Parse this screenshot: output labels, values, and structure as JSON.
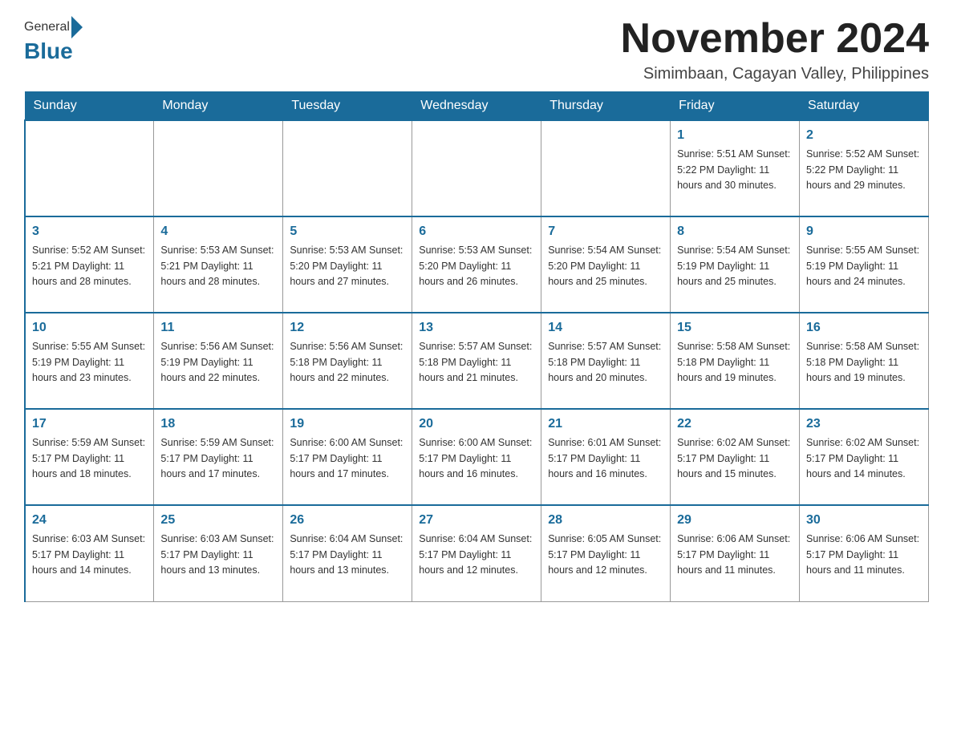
{
  "header": {
    "logo": {
      "general": "General",
      "blue": "Blue"
    },
    "title": "November 2024",
    "subtitle": "Simimbaan, Cagayan Valley, Philippines"
  },
  "weekdays": [
    "Sunday",
    "Monday",
    "Tuesday",
    "Wednesday",
    "Thursday",
    "Friday",
    "Saturday"
  ],
  "weeks": [
    [
      {
        "day": "",
        "info": ""
      },
      {
        "day": "",
        "info": ""
      },
      {
        "day": "",
        "info": ""
      },
      {
        "day": "",
        "info": ""
      },
      {
        "day": "",
        "info": ""
      },
      {
        "day": "1",
        "info": "Sunrise: 5:51 AM\nSunset: 5:22 PM\nDaylight: 11 hours and 30 minutes."
      },
      {
        "day": "2",
        "info": "Sunrise: 5:52 AM\nSunset: 5:22 PM\nDaylight: 11 hours and 29 minutes."
      }
    ],
    [
      {
        "day": "3",
        "info": "Sunrise: 5:52 AM\nSunset: 5:21 PM\nDaylight: 11 hours and 28 minutes."
      },
      {
        "day": "4",
        "info": "Sunrise: 5:53 AM\nSunset: 5:21 PM\nDaylight: 11 hours and 28 minutes."
      },
      {
        "day": "5",
        "info": "Sunrise: 5:53 AM\nSunset: 5:20 PM\nDaylight: 11 hours and 27 minutes."
      },
      {
        "day": "6",
        "info": "Sunrise: 5:53 AM\nSunset: 5:20 PM\nDaylight: 11 hours and 26 minutes."
      },
      {
        "day": "7",
        "info": "Sunrise: 5:54 AM\nSunset: 5:20 PM\nDaylight: 11 hours and 25 minutes."
      },
      {
        "day": "8",
        "info": "Sunrise: 5:54 AM\nSunset: 5:19 PM\nDaylight: 11 hours and 25 minutes."
      },
      {
        "day": "9",
        "info": "Sunrise: 5:55 AM\nSunset: 5:19 PM\nDaylight: 11 hours and 24 minutes."
      }
    ],
    [
      {
        "day": "10",
        "info": "Sunrise: 5:55 AM\nSunset: 5:19 PM\nDaylight: 11 hours and 23 minutes."
      },
      {
        "day": "11",
        "info": "Sunrise: 5:56 AM\nSunset: 5:19 PM\nDaylight: 11 hours and 22 minutes."
      },
      {
        "day": "12",
        "info": "Sunrise: 5:56 AM\nSunset: 5:18 PM\nDaylight: 11 hours and 22 minutes."
      },
      {
        "day": "13",
        "info": "Sunrise: 5:57 AM\nSunset: 5:18 PM\nDaylight: 11 hours and 21 minutes."
      },
      {
        "day": "14",
        "info": "Sunrise: 5:57 AM\nSunset: 5:18 PM\nDaylight: 11 hours and 20 minutes."
      },
      {
        "day": "15",
        "info": "Sunrise: 5:58 AM\nSunset: 5:18 PM\nDaylight: 11 hours and 19 minutes."
      },
      {
        "day": "16",
        "info": "Sunrise: 5:58 AM\nSunset: 5:18 PM\nDaylight: 11 hours and 19 minutes."
      }
    ],
    [
      {
        "day": "17",
        "info": "Sunrise: 5:59 AM\nSunset: 5:17 PM\nDaylight: 11 hours and 18 minutes."
      },
      {
        "day": "18",
        "info": "Sunrise: 5:59 AM\nSunset: 5:17 PM\nDaylight: 11 hours and 17 minutes."
      },
      {
        "day": "19",
        "info": "Sunrise: 6:00 AM\nSunset: 5:17 PM\nDaylight: 11 hours and 17 minutes."
      },
      {
        "day": "20",
        "info": "Sunrise: 6:00 AM\nSunset: 5:17 PM\nDaylight: 11 hours and 16 minutes."
      },
      {
        "day": "21",
        "info": "Sunrise: 6:01 AM\nSunset: 5:17 PM\nDaylight: 11 hours and 16 minutes."
      },
      {
        "day": "22",
        "info": "Sunrise: 6:02 AM\nSunset: 5:17 PM\nDaylight: 11 hours and 15 minutes."
      },
      {
        "day": "23",
        "info": "Sunrise: 6:02 AM\nSunset: 5:17 PM\nDaylight: 11 hours and 14 minutes."
      }
    ],
    [
      {
        "day": "24",
        "info": "Sunrise: 6:03 AM\nSunset: 5:17 PM\nDaylight: 11 hours and 14 minutes."
      },
      {
        "day": "25",
        "info": "Sunrise: 6:03 AM\nSunset: 5:17 PM\nDaylight: 11 hours and 13 minutes."
      },
      {
        "day": "26",
        "info": "Sunrise: 6:04 AM\nSunset: 5:17 PM\nDaylight: 11 hours and 13 minutes."
      },
      {
        "day": "27",
        "info": "Sunrise: 6:04 AM\nSunset: 5:17 PM\nDaylight: 11 hours and 12 minutes."
      },
      {
        "day": "28",
        "info": "Sunrise: 6:05 AM\nSunset: 5:17 PM\nDaylight: 11 hours and 12 minutes."
      },
      {
        "day": "29",
        "info": "Sunrise: 6:06 AM\nSunset: 5:17 PM\nDaylight: 11 hours and 11 minutes."
      },
      {
        "day": "30",
        "info": "Sunrise: 6:06 AM\nSunset: 5:17 PM\nDaylight: 11 hours and 11 minutes."
      }
    ]
  ]
}
